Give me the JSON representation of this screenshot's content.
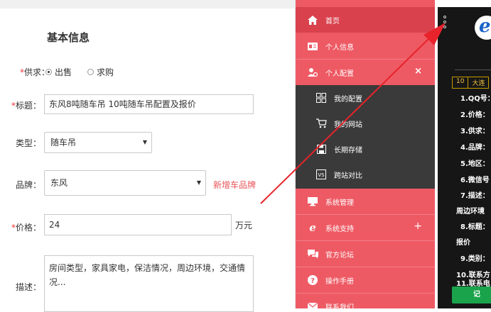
{
  "form": {
    "title": "基本信息",
    "supply": {
      "required": "*",
      "label": "供求：",
      "options": [
        "出售",
        "求购"
      ],
      "selected": "出售"
    },
    "title_field": {
      "required": "*",
      "label": "标题：",
      "value": "东风8吨随车吊 10吨随车吊配置及报价"
    },
    "type_field": {
      "label": "类型：",
      "value": "随车吊"
    },
    "brand_field": {
      "label": "品牌：",
      "value": "东风",
      "add_link": "新增车品牌"
    },
    "price_field": {
      "required": "*",
      "label": "价格：",
      "value": "24",
      "unit": "万元"
    },
    "desc_field": {
      "label": "描述：",
      "value_line1": "房间类型，家具家电，保洁情况，周边环境，交通情",
      "value_line2": "况..."
    }
  },
  "menu": {
    "home": "首页",
    "profile": "个人信息",
    "config": "个人配置",
    "config_close": "×",
    "sub": [
      "我的配置",
      "我的网站",
      "长期存储",
      "跨站对比"
    ],
    "system_manage": "系统管理",
    "system_support": "系统支持",
    "system_support_expand": "+",
    "forum": "官方论坛",
    "manual": "操作手册",
    "contact": "联系我们"
  },
  "panel": {
    "badge_num": "10",
    "badge_text": "大连",
    "lines": [
      "1.QQ号：",
      "2.价格：",
      "3.供求：",
      "4.品牌：",
      "5.地区：",
      "6.微信号",
      "7.描述：",
      "周边环境",
      "8.标题：",
      "报价",
      "9.类别：",
      "10.联系方",
      "11.联系电"
    ],
    "button": "记"
  },
  "colors": {
    "menu_bg": "#ee5a64",
    "menu_active": "#d9414d",
    "submenu_bg": "#3a3a3a",
    "arrow": "#e8232b",
    "panel_bg": "#161616",
    "required": "#e33333"
  }
}
